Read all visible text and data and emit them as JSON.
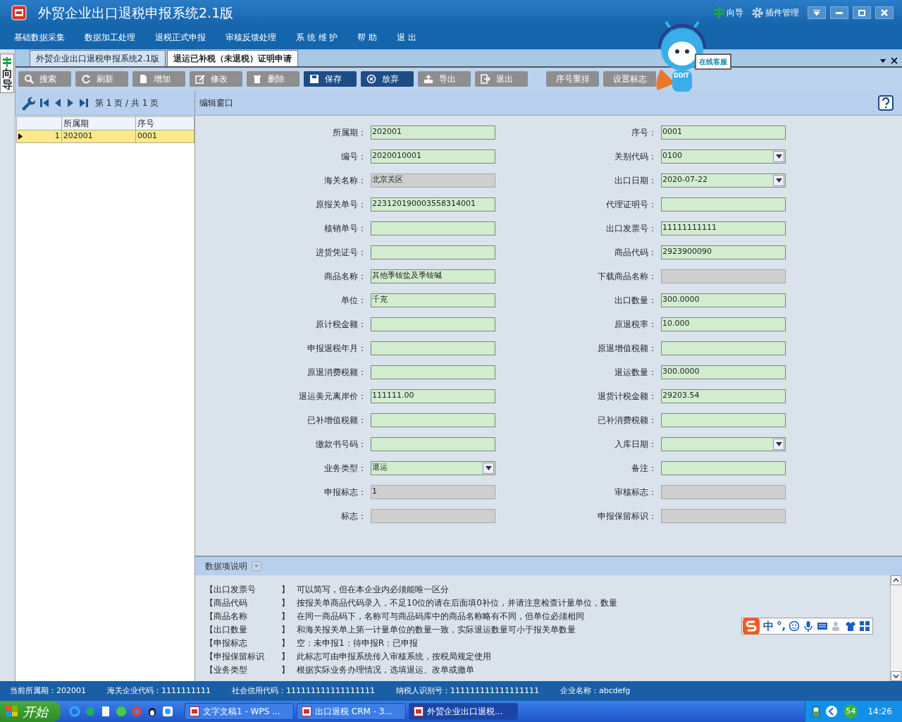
{
  "window": {
    "title": "外贸企业出口退税申报系统2.1版",
    "top_links": [
      {
        "kind": "guide",
        "label": "向导"
      },
      {
        "kind": "plugin",
        "label": "插件管理"
      }
    ]
  },
  "menu": [
    "基础数据采集",
    "数据加工处理",
    "退税正式申报",
    "审核反馈处理",
    "系 统 维 护",
    "帮  助",
    "退  出"
  ],
  "side_tab": {
    "label": "向导"
  },
  "doc_tabs": [
    {
      "label": "外贸企业出口退税申报系统2.1版",
      "selected": false
    },
    {
      "label": "退运已补税（未退税）证明申请",
      "selected": true
    }
  ],
  "toolbar": [
    {
      "kind": "search",
      "label": "搜索",
      "enabled": false
    },
    {
      "kind": "refresh",
      "label": "刷新",
      "enabled": false
    },
    {
      "kind": "add",
      "label": "增加",
      "enabled": false
    },
    {
      "kind": "edit",
      "label": "修改",
      "enabled": false
    },
    {
      "kind": "delete",
      "label": "删除",
      "enabled": false
    },
    {
      "kind": "save",
      "label": "保存",
      "enabled": true
    },
    {
      "kind": "cancel",
      "label": "放弃",
      "enabled": true
    },
    {
      "kind": "export",
      "label": "导出",
      "enabled": false
    },
    {
      "kind": "exit",
      "label": "退出",
      "enabled": false
    },
    {
      "kind": "plain",
      "label": "序号重排",
      "enabled": false
    },
    {
      "kind": "plain",
      "label": "设置标志",
      "enabled": false
    }
  ],
  "mascot": {
    "badge": "在线客服",
    "chest": "DDIT"
  },
  "pager": {
    "text": "第 1 页 / 共 1 页"
  },
  "grid": {
    "columns": [
      "所属期",
      "序号"
    ],
    "rows": [
      {
        "index": "1",
        "cells": [
          "202001",
          "0001"
        ],
        "selected": true
      }
    ]
  },
  "editor": {
    "title": "编辑窗口",
    "left": [
      {
        "label": "所属期：",
        "value": "202001",
        "kind": "text",
        "editable": true
      },
      {
        "label": "编号：",
        "value": "2020010001",
        "kind": "text",
        "editable": true
      },
      {
        "label": "海关名称：",
        "value": "北京关区",
        "kind": "text",
        "editable": false
      },
      {
        "label": "原报关单号：",
        "value": "223120190003558314001",
        "kind": "text",
        "editable": true
      },
      {
        "label": "核销单号：",
        "kind": "text",
        "editable": true
      },
      {
        "label": "进货凭证号：",
        "kind": "text",
        "editable": true
      },
      {
        "label": "商品名称：",
        "value": "其他季铵盐及季铵碱",
        "kind": "text",
        "editable": true
      },
      {
        "label": "单位：",
        "value": "千克",
        "kind": "text",
        "editable": true
      },
      {
        "label": "原计税金额：",
        "kind": "text",
        "editable": true
      },
      {
        "label": "申报退税年月：",
        "kind": "text",
        "editable": true
      },
      {
        "label": "原退消费税额：",
        "kind": "text",
        "editable": true
      },
      {
        "label": "退运美元离岸价：",
        "value": "111111.00",
        "kind": "text",
        "editable": true
      },
      {
        "label": "已补增值税额：",
        "kind": "text",
        "editable": true
      },
      {
        "label": "缴款书号码：",
        "kind": "text",
        "editable": true
      },
      {
        "label": "业务类型：",
        "value": "退运",
        "kind": "select",
        "editable": true
      },
      {
        "label": "申报标志：",
        "value": "1",
        "kind": "text",
        "editable": false
      },
      {
        "label": "标志：",
        "kind": "text",
        "editable": false
      }
    ],
    "right": [
      {
        "label": "序号：",
        "value": "0001",
        "kind": "text",
        "editable": true
      },
      {
        "label": "关别代码：",
        "value": "0100",
        "kind": "select",
        "editable": true
      },
      {
        "label": "出口日期：",
        "value": "2020-07-22",
        "kind": "select",
        "editable": true
      },
      {
        "label": "代理证明号：",
        "kind": "text",
        "editable": true
      },
      {
        "label": "出口发票号：",
        "value": "11111111111",
        "kind": "text",
        "editable": true
      },
      {
        "label": "商品代码：",
        "value": "2923900090",
        "kind": "text",
        "editable": true
      },
      {
        "label": "下载商品名称：",
        "kind": "text",
        "editable": false
      },
      {
        "label": "出口数量：",
        "value": "300.0000",
        "kind": "text",
        "editable": true
      },
      {
        "label": "原退税率：",
        "value": "10.000",
        "kind": "text",
        "editable": true
      },
      {
        "label": "原退增值税额：",
        "kind": "text",
        "editable": true
      },
      {
        "label": "退运数量：",
        "value": "300.0000",
        "kind": "text",
        "editable": true
      },
      {
        "label": "退货计税金额：",
        "value": "29203.54",
        "kind": "text",
        "editable": true
      },
      {
        "label": "已补消费税额：",
        "kind": "text",
        "editable": true
      },
      {
        "label": "入库日期：",
        "kind": "select",
        "editable": true
      },
      {
        "label": "备注：",
        "kind": "text",
        "editable": true
      },
      {
        "label": "审核标志：",
        "kind": "text",
        "editable": false
      },
      {
        "label": "申报保留标识：",
        "kind": "text",
        "editable": false
      }
    ]
  },
  "help": {
    "title": "数据项说明",
    "items": [
      {
        "term": "【出口发票号",
        "close": "】",
        "text": "可以简写，但在本企业内必须能唯一区分"
      },
      {
        "term": "【商品代码",
        "close": "】",
        "text": "按报关单商品代码录入，不足10位的请在后面填0补位，并请注意检查计量单位，数量"
      },
      {
        "term": "【商品名称",
        "close": "】",
        "text": "在同一商品码下，名称可与商品码库中的商品名称略有不同，但单位必须相同"
      },
      {
        "term": "【出口数量",
        "close": "】",
        "text": "和海关报关单上第一计量单位的数量一致，实际退运数量可小于报关单数量"
      },
      {
        "term": "【申报标志",
        "close": "】",
        "text": "空：未申报1：待申报R：已申报"
      },
      {
        "term": "【申报保留标识",
        "close": "】",
        "text": "此标志可由申报系统传入审核系统，按税局规定使用"
      },
      {
        "term": "【业务类型",
        "close": "】",
        "text": "根据实际业务办理情况，选填退运、改单或撤单"
      }
    ]
  },
  "ime_bar": {
    "mode": "中",
    "punct": "°,"
  },
  "status_bar": [
    "当前所属期：202001",
    "海关企业代码：1111111111",
    "社会信用代码：111111111111111111",
    "纳税人识别号：111111111111111111",
    "企业名称：abcdefg"
  ],
  "taskbar": {
    "start": "开始",
    "tasks": [
      {
        "label": "文字文稿1 - WPS ...",
        "selected": false
      },
      {
        "label": "出口退税 CRM - 3...",
        "selected": false
      },
      {
        "label": "外贸企业出口退税...",
        "selected": true
      }
    ],
    "badge": "54",
    "clock": "14:26"
  }
}
